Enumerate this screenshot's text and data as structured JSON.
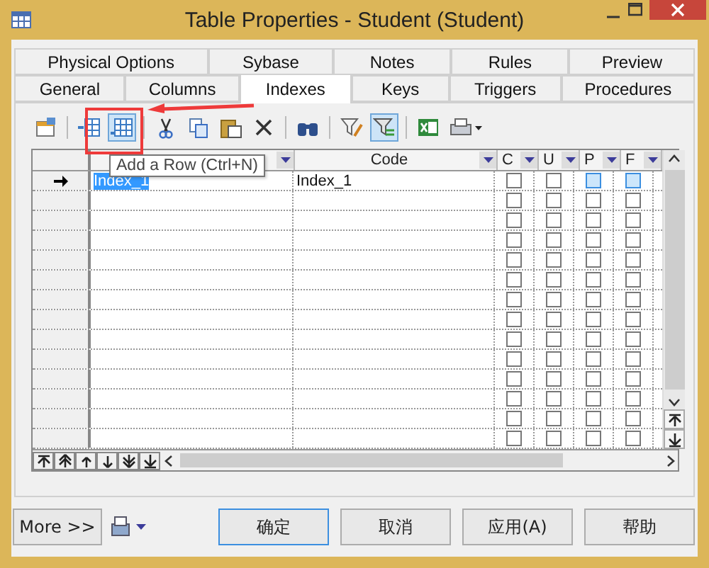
{
  "window": {
    "title": "Table Properties - Student (Student)"
  },
  "tab_rows": [
    [
      {
        "label": "Physical Options",
        "selected": false
      },
      {
        "label": "Sybase",
        "selected": false
      },
      {
        "label": "Notes",
        "selected": false
      },
      {
        "label": "Rules",
        "selected": false
      },
      {
        "label": "Preview",
        "selected": false
      }
    ],
    [
      {
        "label": "General",
        "selected": false
      },
      {
        "label": "Columns",
        "selected": false
      },
      {
        "label": "Indexes",
        "selected": true
      },
      {
        "label": "Keys",
        "selected": false
      },
      {
        "label": "Triggers",
        "selected": false
      },
      {
        "label": "Procedures",
        "selected": false
      }
    ]
  ],
  "toolbar": [
    {
      "kind": "properties",
      "pressed": false
    },
    {
      "kind": "separator"
    },
    {
      "kind": "insert-row",
      "pressed": false
    },
    {
      "kind": "add-row",
      "pressed": true
    },
    {
      "kind": "separator"
    },
    {
      "kind": "cut",
      "pressed": false
    },
    {
      "kind": "copy",
      "pressed": false
    },
    {
      "kind": "paste",
      "pressed": false
    },
    {
      "kind": "delete",
      "pressed": false
    },
    {
      "kind": "separator"
    },
    {
      "kind": "find",
      "pressed": false
    },
    {
      "kind": "separator"
    },
    {
      "kind": "filter-edit",
      "pressed": false
    },
    {
      "kind": "filter",
      "pressed": true
    },
    {
      "kind": "separator"
    },
    {
      "kind": "excel",
      "pressed": false
    },
    {
      "kind": "print",
      "pressed": false
    }
  ],
  "tooltip": "Add a Row (Ctrl+N)",
  "table": {
    "columns": [
      {
        "kind": "text"
      },
      {
        "kind": "text",
        "label": "Code"
      },
      {
        "kind": "check",
        "label": "C"
      },
      {
        "kind": "check",
        "label": "U"
      },
      {
        "kind": "check",
        "label": "P"
      },
      {
        "kind": "check",
        "label": "F"
      }
    ],
    "rows": [
      {
        "current": true,
        "name": "Index_1",
        "name_selected": true,
        "code": "Index_1",
        "checks": [
          {
            "checked": false,
            "focused": false
          },
          {
            "checked": false,
            "focused": false
          },
          {
            "checked": false,
            "focused": true
          },
          {
            "checked": false,
            "focused": true
          }
        ]
      },
      {
        "current": false,
        "checks": [
          {
            "checked": false,
            "focused": false
          },
          {
            "checked": false,
            "focused": false
          },
          {
            "checked": false,
            "focused": false
          },
          {
            "checked": false,
            "focused": false
          }
        ]
      },
      {
        "current": false,
        "checks": [
          {
            "checked": false,
            "focused": false
          },
          {
            "checked": false,
            "focused": false
          },
          {
            "checked": false,
            "focused": false
          },
          {
            "checked": false,
            "focused": false
          }
        ]
      },
      {
        "current": false,
        "checks": [
          {
            "checked": false,
            "focused": false
          },
          {
            "checked": false,
            "focused": false
          },
          {
            "checked": false,
            "focused": false
          },
          {
            "checked": false,
            "focused": false
          }
        ]
      },
      {
        "current": false,
        "checks": [
          {
            "checked": false,
            "focused": false
          },
          {
            "checked": false,
            "focused": false
          },
          {
            "checked": false,
            "focused": false
          },
          {
            "checked": false,
            "focused": false
          }
        ]
      },
      {
        "current": false,
        "checks": [
          {
            "checked": false,
            "focused": false
          },
          {
            "checked": false,
            "focused": false
          },
          {
            "checked": false,
            "focused": false
          },
          {
            "checked": false,
            "focused": false
          }
        ]
      },
      {
        "current": false,
        "checks": [
          {
            "checked": false,
            "focused": false
          },
          {
            "checked": false,
            "focused": false
          },
          {
            "checked": false,
            "focused": false
          },
          {
            "checked": false,
            "focused": false
          }
        ]
      },
      {
        "current": false,
        "checks": [
          {
            "checked": false,
            "focused": false
          },
          {
            "checked": false,
            "focused": false
          },
          {
            "checked": false,
            "focused": false
          },
          {
            "checked": false,
            "focused": false
          }
        ]
      },
      {
        "current": false,
        "checks": [
          {
            "checked": false,
            "focused": false
          },
          {
            "checked": false,
            "focused": false
          },
          {
            "checked": false,
            "focused": false
          },
          {
            "checked": false,
            "focused": false
          }
        ]
      },
      {
        "current": false,
        "checks": [
          {
            "checked": false,
            "focused": false
          },
          {
            "checked": false,
            "focused": false
          },
          {
            "checked": false,
            "focused": false
          },
          {
            "checked": false,
            "focused": false
          }
        ]
      },
      {
        "current": false,
        "checks": [
          {
            "checked": false,
            "focused": false
          },
          {
            "checked": false,
            "focused": false
          },
          {
            "checked": false,
            "focused": false
          },
          {
            "checked": false,
            "focused": false
          }
        ]
      },
      {
        "current": false,
        "checks": [
          {
            "checked": false,
            "focused": false
          },
          {
            "checked": false,
            "focused": false
          },
          {
            "checked": false,
            "focused": false
          },
          {
            "checked": false,
            "focused": false
          }
        ]
      },
      {
        "current": false,
        "checks": [
          {
            "checked": false,
            "focused": false
          },
          {
            "checked": false,
            "focused": false
          },
          {
            "checked": false,
            "focused": false
          },
          {
            "checked": false,
            "focused": false
          }
        ]
      },
      {
        "current": false,
        "checks": [
          {
            "checked": false,
            "focused": false
          },
          {
            "checked": false,
            "focused": false
          },
          {
            "checked": false,
            "focused": false
          },
          {
            "checked": false,
            "focused": false
          }
        ]
      }
    ]
  },
  "buttons": [
    {
      "label": "More >>",
      "kind": "more",
      "focused": false
    },
    {
      "label": "确定",
      "kind": "dialog",
      "focused": true
    },
    {
      "label": "取消",
      "kind": "dialog",
      "focused": false
    },
    {
      "label": "应用(A)",
      "kind": "dialog",
      "focused": false
    },
    {
      "label": "帮助",
      "kind": "dialog",
      "focused": false
    }
  ]
}
